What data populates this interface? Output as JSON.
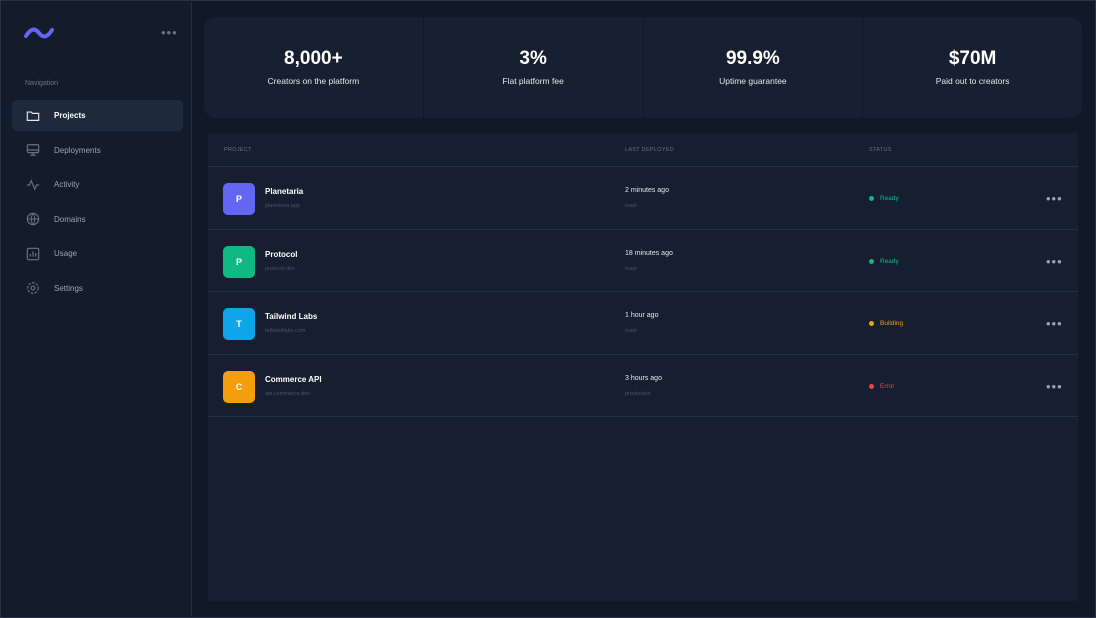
{
  "colors": {
    "brand": "#6366f1",
    "ready": "#10b981",
    "building": "#f59e0b",
    "error": "#ef4444"
  },
  "sidebar": {
    "more_label": "•••",
    "nav_heading": "Navigation",
    "items": [
      {
        "label": "Projects",
        "icon": "folder-icon"
      },
      {
        "label": "Deployments",
        "icon": "server-icon"
      },
      {
        "label": "Activity",
        "icon": "activity-icon"
      },
      {
        "label": "Domains",
        "icon": "globe-icon"
      },
      {
        "label": "Usage",
        "icon": "chart-icon"
      },
      {
        "label": "Settings",
        "icon": "gear-icon"
      }
    ]
  },
  "stats": [
    {
      "value": "8,000+",
      "label": "Creators on the platform"
    },
    {
      "value": "3%",
      "label": "Flat platform fee"
    },
    {
      "value": "99.9%",
      "label": "Uptime guarantee"
    },
    {
      "value": "$70M",
      "label": "Paid out to creators"
    }
  ],
  "table": {
    "headers": {
      "project": "PROJECT",
      "last_deployed": "LAST DEPLOYED",
      "status": "STATUS"
    },
    "rows": [
      {
        "initial": "P",
        "name": "Planetaria",
        "domain": "planetaria.app",
        "deployed": "2 minutes ago",
        "branch": "main",
        "status": "Ready",
        "avatar_color": "#6366f1",
        "status_color": "#10b981"
      },
      {
        "initial": "P",
        "name": "Protocol",
        "domain": "protocol.dev",
        "deployed": "18 minutes ago",
        "branch": "main",
        "status": "Ready",
        "avatar_color": "#10b981",
        "status_color": "#10b981"
      },
      {
        "initial": "T",
        "name": "Tailwind Labs",
        "domain": "tailwindlabs.com",
        "deployed": "1 hour ago",
        "branch": "main",
        "status": "Building",
        "avatar_color": "#0ea5e9",
        "status_color": "#f59e0b"
      },
      {
        "initial": "C",
        "name": "Commerce API",
        "domain": "api.commerce.dev",
        "deployed": "3 hours ago",
        "branch": "production",
        "status": "Error",
        "avatar_color": "#f59e0b",
        "status_color": "#ef4444"
      }
    ],
    "row_more_label": "•••"
  }
}
